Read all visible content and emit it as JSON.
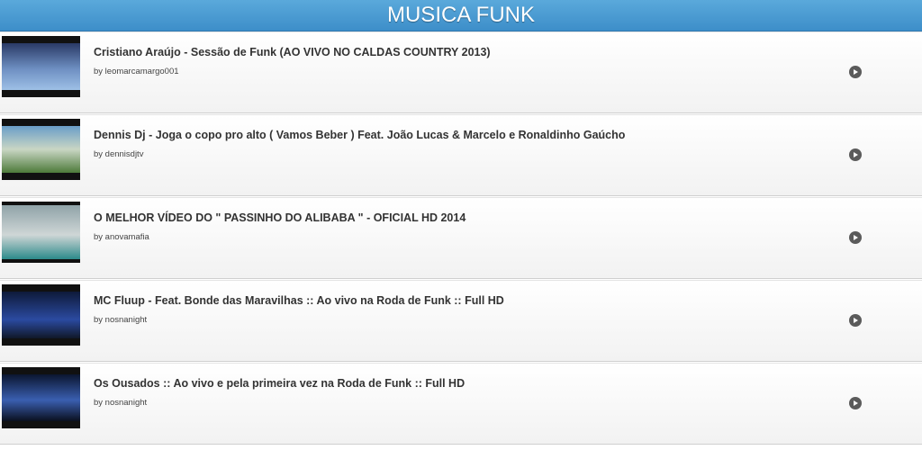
{
  "header": {
    "title": "MUSICA FUNK"
  },
  "videos": [
    {
      "title": "Cristiano Araújo - Sessão de Funk (AO VIVO NO CALDAS COUNTRY 2013)",
      "byline": "by leomarcamargo001",
      "thumb_colors": [
        "#2a3a66",
        "#9ec0e6"
      ]
    },
    {
      "title": "Dennis Dj - Joga o copo pro alto ( Vamos Beber ) Feat. João Lucas & Marcelo e Ronaldinho Gaúcho",
      "byline": "by dennisdjtv",
      "thumb_colors": [
        "#6a9ec8",
        "#4d7a3a"
      ]
    },
    {
      "title": "O MELHOR VÍDEO DO \" PASSINHO DO ALIBABA \" - OFICIAL HD 2014",
      "byline": "by anovamafia",
      "thumb_colors": [
        "#8fa3a8",
        "#2c8a8a"
      ]
    },
    {
      "title": "MC Fluup - Feat. Bonde das Maravilhas :: Ao vivo na Roda de Funk :: Full HD",
      "byline": "by nosnanight",
      "thumb_colors": [
        "#0e1a3a",
        "#2b4aa0"
      ]
    },
    {
      "title": "Os Ousados :: Ao vivo e pela primeira vez na Roda de Funk :: Full HD",
      "byline": "by nosnanight",
      "thumb_colors": [
        "#0b1630",
        "#3a5fb0"
      ]
    }
  ]
}
